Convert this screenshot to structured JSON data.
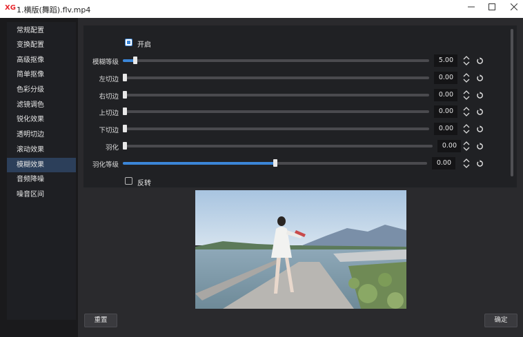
{
  "window": {
    "logo": "XG",
    "title": "1.横版(舞蹈).flv.mp4"
  },
  "sidebar": {
    "items": [
      {
        "label": "常规配置"
      },
      {
        "label": "变换配置"
      },
      {
        "label": "高级抠像"
      },
      {
        "label": "简单抠像"
      },
      {
        "label": "色彩分级"
      },
      {
        "label": "滤镜调色"
      },
      {
        "label": "锐化效果"
      },
      {
        "label": "透明切边"
      },
      {
        "label": "滚动效果"
      },
      {
        "label": "模糊效果"
      },
      {
        "label": "音频降噪"
      },
      {
        "label": "噪音区间"
      }
    ],
    "active_index": 9
  },
  "settings": {
    "enable": {
      "label": "开启",
      "checked": true
    },
    "rows": [
      {
        "label": "模糊等级",
        "value": "5.00",
        "fraction": 0.04
      },
      {
        "label": "左切边",
        "value": "0.00",
        "fraction": 0
      },
      {
        "label": "右切边",
        "value": "0.00",
        "fraction": 0
      },
      {
        "label": "上切边",
        "value": "0.00",
        "fraction": 0
      },
      {
        "label": "下切边",
        "value": "0.00",
        "fraction": 0
      },
      {
        "label": "羽化",
        "value": "0.00",
        "fraction": 0
      },
      {
        "label": "羽化等级",
        "value": "0.00",
        "fraction": 0.5
      }
    ],
    "invert": {
      "label": "反转",
      "checked": false
    }
  },
  "preview": {
    "watermark": ""
  },
  "buttons": {
    "reset": "重置",
    "confirm": "确定"
  },
  "colors": {
    "accent": "#3b86d8",
    "active_item": "#2c3f5a"
  }
}
